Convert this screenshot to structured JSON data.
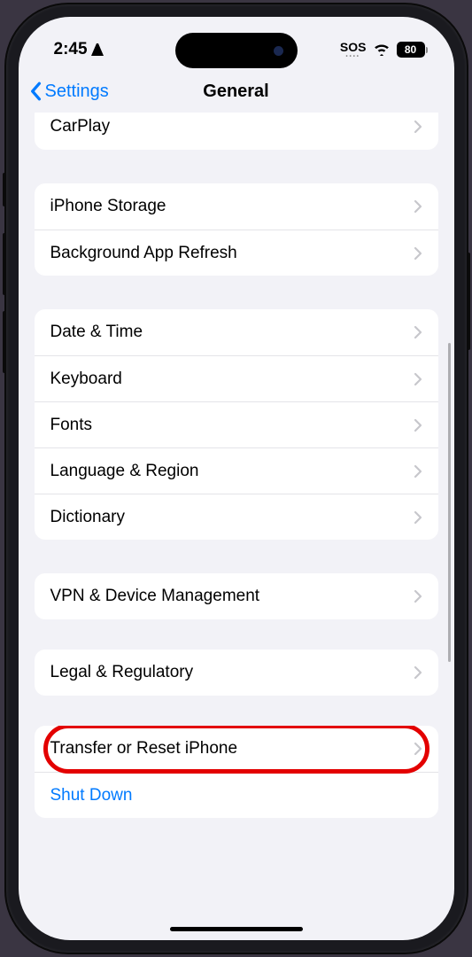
{
  "statusBar": {
    "time": "2:45",
    "sos": "SOS",
    "battery": "80"
  },
  "nav": {
    "back": "Settings",
    "title": "General"
  },
  "groups": {
    "g0": {
      "carplay": "CarPlay"
    },
    "g1": {
      "storage": "iPhone Storage",
      "bgRefresh": "Background App Refresh"
    },
    "g2": {
      "dateTime": "Date & Time",
      "keyboard": "Keyboard",
      "fonts": "Fonts",
      "langRegion": "Language & Region",
      "dictionary": "Dictionary"
    },
    "g3": {
      "vpn": "VPN & Device Management"
    },
    "g4": {
      "legal": "Legal & Regulatory"
    },
    "g5": {
      "transfer": "Transfer or Reset iPhone",
      "shutdown": "Shut Down"
    }
  }
}
